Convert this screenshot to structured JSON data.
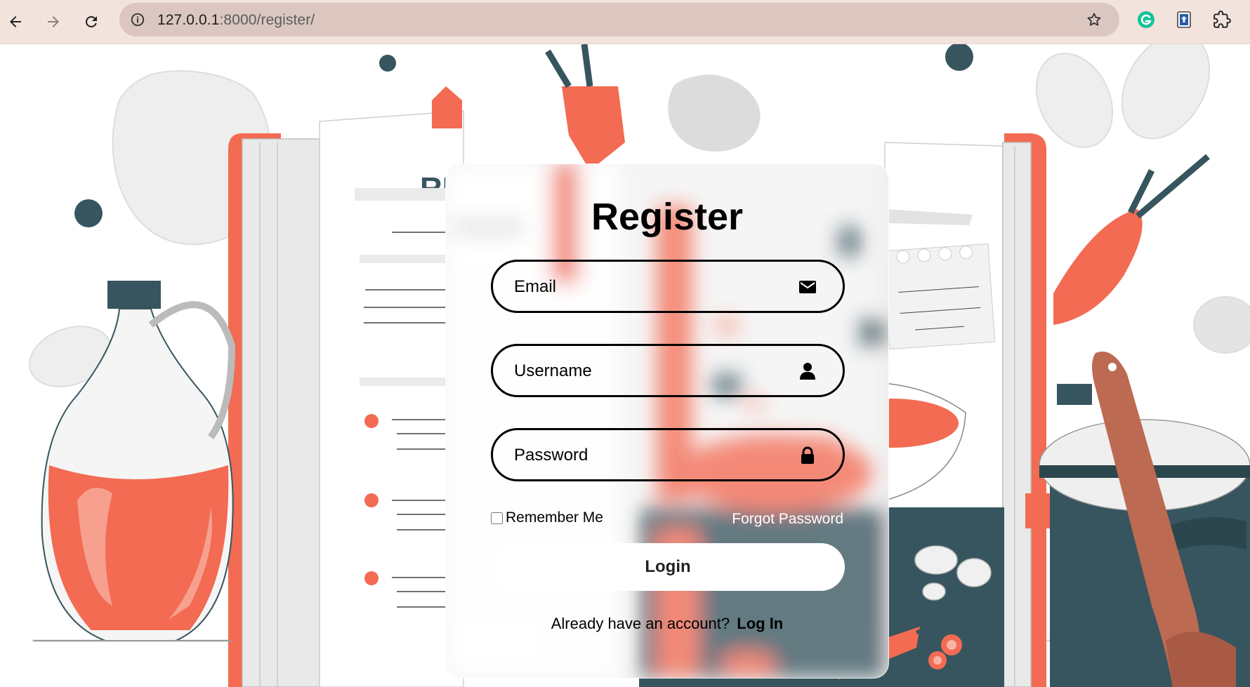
{
  "browser": {
    "url_host": "127.0.0.1",
    "url_rest": ":8000/register/"
  },
  "form": {
    "title": "Register",
    "email_placeholder": "Email",
    "username_placeholder": "Username",
    "password_placeholder": "Password",
    "remember_label": "Remember Me",
    "remember_checked": false,
    "forgot_label": "Forgot Password",
    "submit_label": "Login",
    "footer_prompt": "Already have an account?",
    "footer_link": "Log In"
  },
  "icons": {
    "back": "arrow-left-icon",
    "forward": "arrow-right-icon",
    "reload": "reload-icon",
    "site_info": "info-icon",
    "bookmark": "star-icon",
    "grammarly": "grammarly-icon",
    "extension_a": "upload-extension-icon",
    "extensions": "puzzle-icon",
    "email": "envelope-icon",
    "username": "user-icon",
    "password": "lock-icon"
  },
  "colors": {
    "accent": "#f26b52",
    "dark": "#37555e",
    "chrome_bg": "#f3e3dd",
    "omnibox_bg": "#dbc7c0"
  }
}
